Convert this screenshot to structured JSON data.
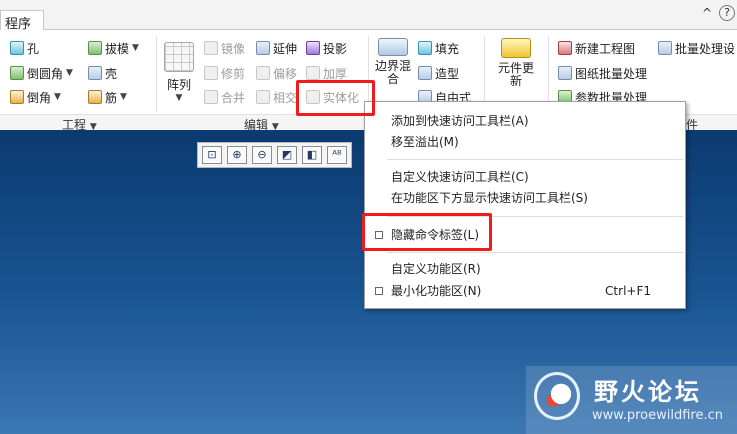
{
  "tabs": {
    "active": "程序"
  },
  "icons": {
    "collapse": "^",
    "help": "?"
  },
  "ribbon": {
    "engineering": {
      "hole": "孔",
      "draft": "拔模",
      "round": "倒圆角",
      "shell": "壳",
      "chamfer": "倒角",
      "rib": "筋"
    },
    "pattern": {
      "label": "阵列"
    },
    "editing": {
      "mirror": "镜像",
      "extend": "延伸",
      "project": "投影",
      "trim": "修剪",
      "offset": "偏移",
      "thicken": "加厚",
      "merge": "合并",
      "intersect": "相交",
      "solidify": "实体化"
    },
    "surface": {
      "boundary_blend": "边界混合",
      "fill": "填充",
      "style": "造型",
      "freestyle": "自由式"
    },
    "component": {
      "label": "元件更新"
    },
    "tools": {
      "new_drawing": "新建工程图",
      "batch_process": "批量处理设",
      "drawing_batch": "图纸批量处理",
      "param_batch": "参数批量处理"
    },
    "groups": {
      "engineering": "工程",
      "editing": "编辑",
      "tools_tail": "件"
    }
  },
  "view_toolbar": {
    "refit": "⊡",
    "zoom_in": "⊕",
    "zoom_out": "⊖",
    "repaint": "◩",
    "orient": "◧",
    "annot": "ᴬᴮ"
  },
  "context_menu": {
    "items": [
      {
        "label": "添加到快速访问工具栏(A)"
      },
      {
        "label": "移至溢出(M)"
      },
      {
        "label": "自定义快速访问工具栏(C)"
      },
      {
        "label": "在功能区下方显示快速访问工具栏(S)"
      },
      {
        "label": "隐藏命令标签(L)"
      },
      {
        "label": "自定义功能区(R)"
      },
      {
        "label": "最小化功能区(N)",
        "shortcut": "Ctrl+F1"
      }
    ]
  },
  "watermark": {
    "title": "野火论坛",
    "url": "www.proewildfire.cn"
  }
}
